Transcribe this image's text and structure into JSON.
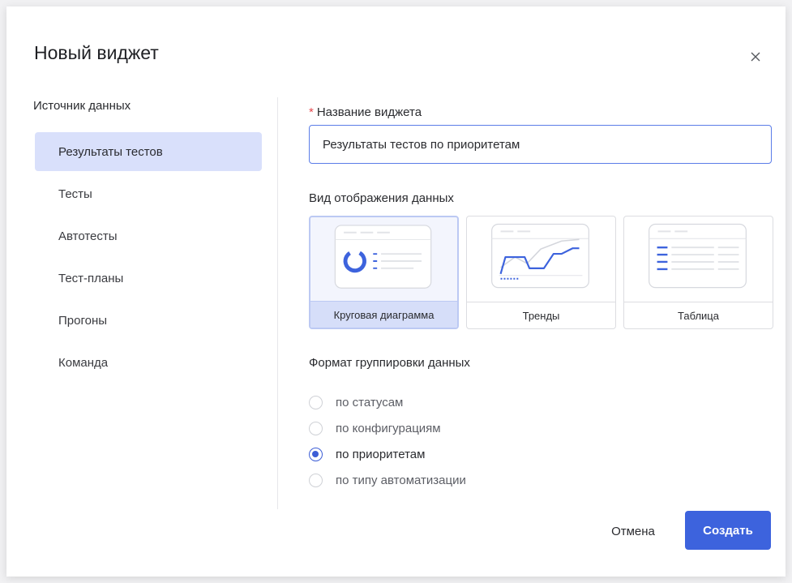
{
  "dialog": {
    "title": "Новый виджет",
    "close_icon": "close-icon"
  },
  "source": {
    "label": "Источник данных",
    "items": [
      {
        "label": "Результаты тестов",
        "active": true
      },
      {
        "label": "Тесты",
        "active": false
      },
      {
        "label": "Автотесты",
        "active": false
      },
      {
        "label": "Тест-планы",
        "active": false
      },
      {
        "label": "Прогоны",
        "active": false
      },
      {
        "label": "Команда",
        "active": false
      }
    ]
  },
  "name_field": {
    "required_mark": "*",
    "label": "Название виджета",
    "value": "Результаты тестов по приоритетам"
  },
  "view": {
    "label": "Вид отображения данных",
    "options": [
      {
        "label": "Круговая диаграмма",
        "icon": "pie-chart-icon",
        "selected": true
      },
      {
        "label": "Тренды",
        "icon": "trend-chart-icon",
        "selected": false
      },
      {
        "label": "Таблица",
        "icon": "table-icon",
        "selected": false
      }
    ]
  },
  "grouping": {
    "label": "Формат группировки данных",
    "options": [
      {
        "label": "по статусам",
        "checked": false
      },
      {
        "label": "по конфигурациям",
        "checked": false
      },
      {
        "label": "по приоритетам",
        "checked": true
      },
      {
        "label": "по типу автоматизации",
        "checked": false
      }
    ]
  },
  "footer": {
    "cancel_label": "Отмена",
    "create_label": "Создать"
  },
  "colors": {
    "accent": "#3d63dd",
    "selected_bg": "#d9e0fb",
    "required": "#e5484d"
  }
}
